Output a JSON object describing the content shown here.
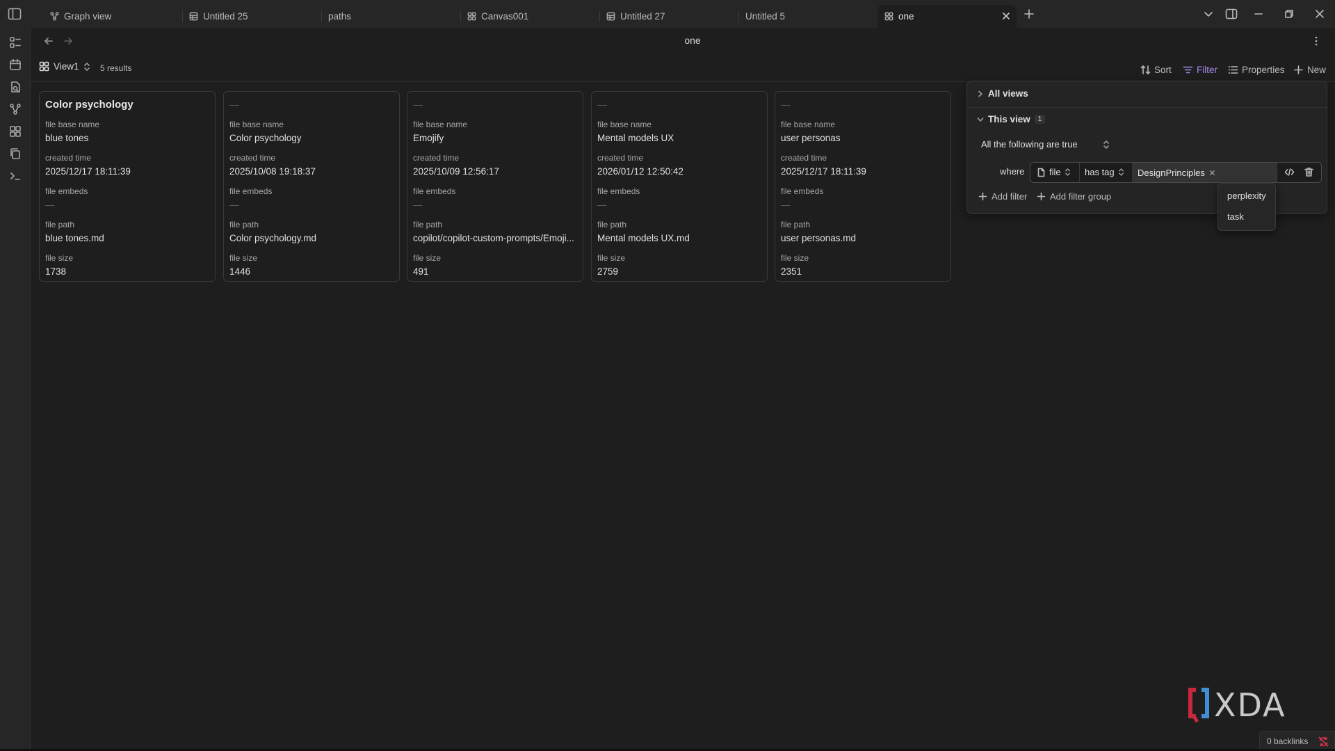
{
  "tabs": [
    {
      "label": "Graph view",
      "icon": "graph-icon"
    },
    {
      "label": "Untitled 25",
      "icon": "table-icon"
    },
    {
      "label": "paths",
      "icon": ""
    },
    {
      "label": "Canvas001",
      "icon": "canvas-icon"
    },
    {
      "label": "Untitled 27",
      "icon": "table-icon"
    },
    {
      "label": "Untitled 5",
      "icon": ""
    },
    {
      "label": "one",
      "icon": "cards-icon",
      "active": true
    }
  ],
  "header": {
    "title": "one"
  },
  "toolbar": {
    "view_label": "View1",
    "results": "5 results",
    "sort_label": "Sort",
    "filter_label": "Filter",
    "properties_label": "Properties",
    "new_label": "New"
  },
  "cards": [
    {
      "title": "Color psychology",
      "base_name": "blue tones",
      "created": "2025/12/17 18:11:39",
      "embeds": "—",
      "path": "blue tones.md",
      "size": "1738"
    },
    {
      "title": "—",
      "base_name": "Color psychology",
      "created": "2025/10/08 19:18:37",
      "embeds": "—",
      "path": "Color psychology.md",
      "size": "1446"
    },
    {
      "title": "—",
      "base_name": "Emojify",
      "created": "2025/10/09 12:56:17",
      "embeds": "—",
      "path": "copilot/copilot-custom-prompts/Emoji...",
      "size": "491"
    },
    {
      "title": "—",
      "base_name": "Mental models UX",
      "created": "2026/01/12 12:50:42",
      "embeds": "—",
      "path": "Mental models UX.md",
      "size": "2759"
    },
    {
      "title": "—",
      "base_name": "user personas",
      "created": "2025/12/17 18:11:39",
      "embeds": "—",
      "path": "user personas.md",
      "size": "2351"
    }
  ],
  "prop_labels": {
    "base_name": "file base name",
    "created": "created time",
    "embeds": "file embeds",
    "path": "file path",
    "size": "file size"
  },
  "filter_panel": {
    "all_views": "All views",
    "this_view": "This view",
    "this_view_count": "1",
    "conjunction": "All the following are true",
    "where": "where",
    "property": "file",
    "operator": "has tag",
    "value": "DesignPrinciples",
    "add_filter": "Add filter",
    "add_filter_group": "Add filter group"
  },
  "suggestions": [
    "perplexity",
    "task"
  ],
  "status": {
    "backlinks": "0 backlinks"
  },
  "watermark": "XDA",
  "colors": {
    "accent": "#a48cf0",
    "background": "#1e1e1e",
    "panel": "#262626",
    "sync_error": "#e0334d"
  }
}
